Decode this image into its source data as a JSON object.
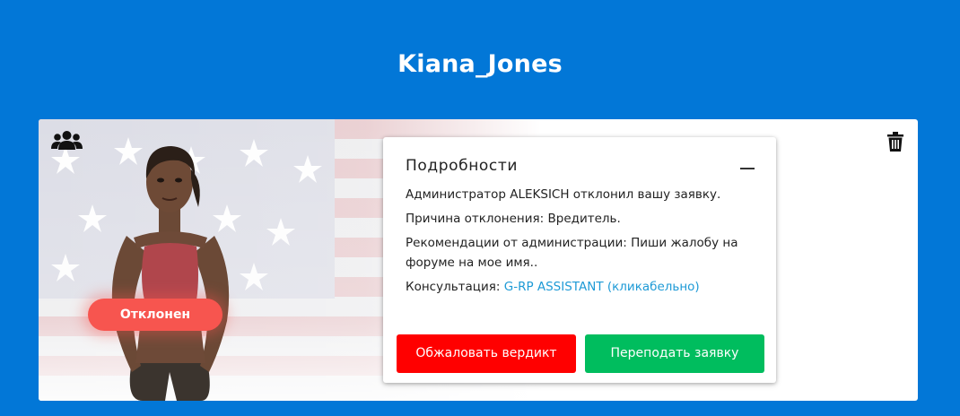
{
  "header": {
    "title": "Kiana_Jones"
  },
  "card": {
    "status_badge": "Отклонен",
    "details": {
      "title": "Подробности",
      "admin_line": "Администратор ALEKSICH отклонил вашу заявку.",
      "reason_line": "Причина отклонения: Вредитель.",
      "recommendation_line": "Рекомендации от администрации: Пиши жалобу на форуме на мое имя..",
      "consult_label": "Консультация: ",
      "consult_link": "G-RP ASSISTANT (кликабельно)",
      "appeal_button": "Обжаловать вердикт",
      "transfer_button": "Переподать заявку"
    },
    "icons": {
      "group": "users-group-icon",
      "delete": "trash-icon",
      "collapse": "minus-icon"
    }
  },
  "colors": {
    "background": "#0277d7",
    "badge": "#f7554f",
    "appeal": "#ff0000",
    "transfer": "#00bd5e",
    "link": "#1e9ad6"
  }
}
